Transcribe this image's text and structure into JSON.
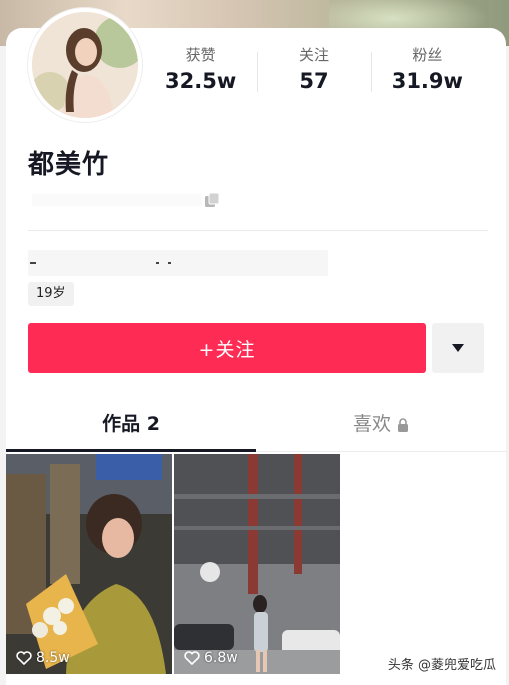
{
  "profile": {
    "name": "都美竹",
    "age_tag": "19岁",
    "stats": [
      {
        "label": "获赞",
        "value": "32.5w"
      },
      {
        "label": "关注",
        "value": "57"
      },
      {
        "label": "粉丝",
        "value": "31.9w"
      }
    ]
  },
  "actions": {
    "follow_label": "+关注"
  },
  "tabs": [
    {
      "label": "作品 2"
    },
    {
      "label": "喜欢"
    }
  ],
  "videos": [
    {
      "likes": "8.5w"
    },
    {
      "likes": "6.8w"
    }
  ],
  "watermark": "头条 @菱兜爱吃瓜",
  "colors": {
    "accent": "#fe2c55",
    "text": "#161823"
  }
}
